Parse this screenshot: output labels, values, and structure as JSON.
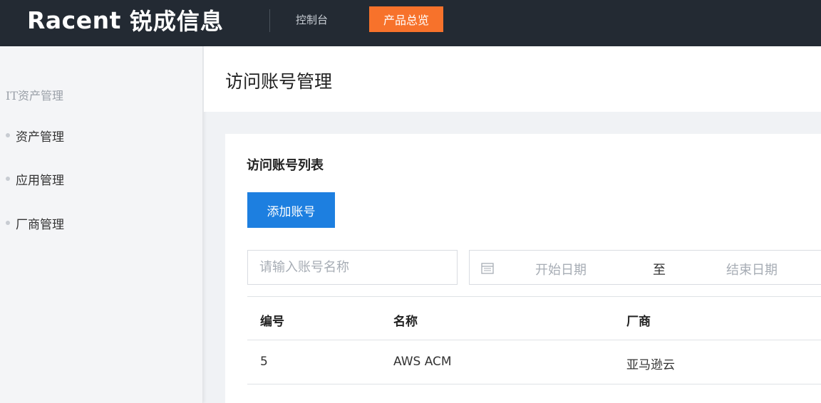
{
  "header": {
    "logo_en": "Racent",
    "logo_cn": "锐成信息",
    "nav_console": "控制台",
    "nav_products": "产品总览",
    "accent_color": "#f7722b"
  },
  "sidebar": {
    "group_label": "IT资产管理",
    "items": [
      {
        "label": "资产管理"
      },
      {
        "label": "应用管理"
      },
      {
        "label": "厂商管理"
      }
    ]
  },
  "page": {
    "title": "访问账号管理"
  },
  "card": {
    "title": "访问账号列表",
    "add_button": "添加账号",
    "search_placeholder": "请输入账号名称",
    "date_start": "开始日期",
    "date_sep": "至",
    "date_end": "结束日期",
    "primary_color": "#1d7fe0"
  },
  "table": {
    "columns": [
      "编号",
      "名称",
      "厂商"
    ],
    "rows": [
      [
        "5",
        "AWS ACM",
        "亚马逊云"
      ]
    ]
  }
}
